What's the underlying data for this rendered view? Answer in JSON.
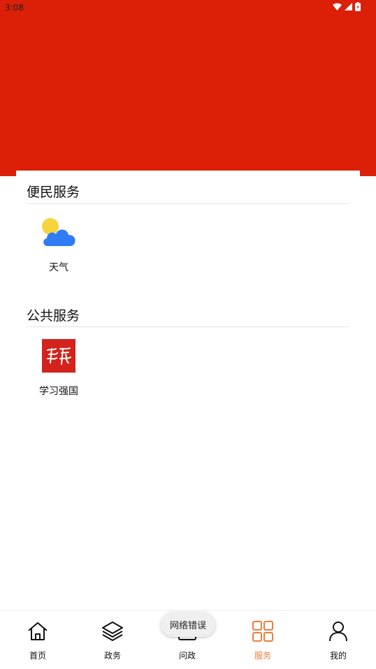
{
  "status_bar": {
    "time": "3:08"
  },
  "colors": {
    "brand": "#db2007",
    "active_tab": "#f07c3a"
  },
  "sections": [
    {
      "title": "便民服务",
      "items": [
        {
          "label": "天气",
          "icon": "weather-icon"
        }
      ]
    },
    {
      "title": "公共服务",
      "items": [
        {
          "label": "学习强国",
          "icon": "xuexi-qiangguo-icon"
        }
      ]
    }
  ],
  "bottom_nav": [
    {
      "label": "首页",
      "icon": "home-icon",
      "active": false
    },
    {
      "label": "政务",
      "icon": "layers-icon",
      "active": false
    },
    {
      "label": "问政",
      "icon": "question-icon",
      "active": false
    },
    {
      "label": "服务",
      "icon": "grid-icon",
      "active": true
    },
    {
      "label": "我的",
      "icon": "user-icon",
      "active": false
    }
  ],
  "toast": {
    "text": "网络错误"
  }
}
